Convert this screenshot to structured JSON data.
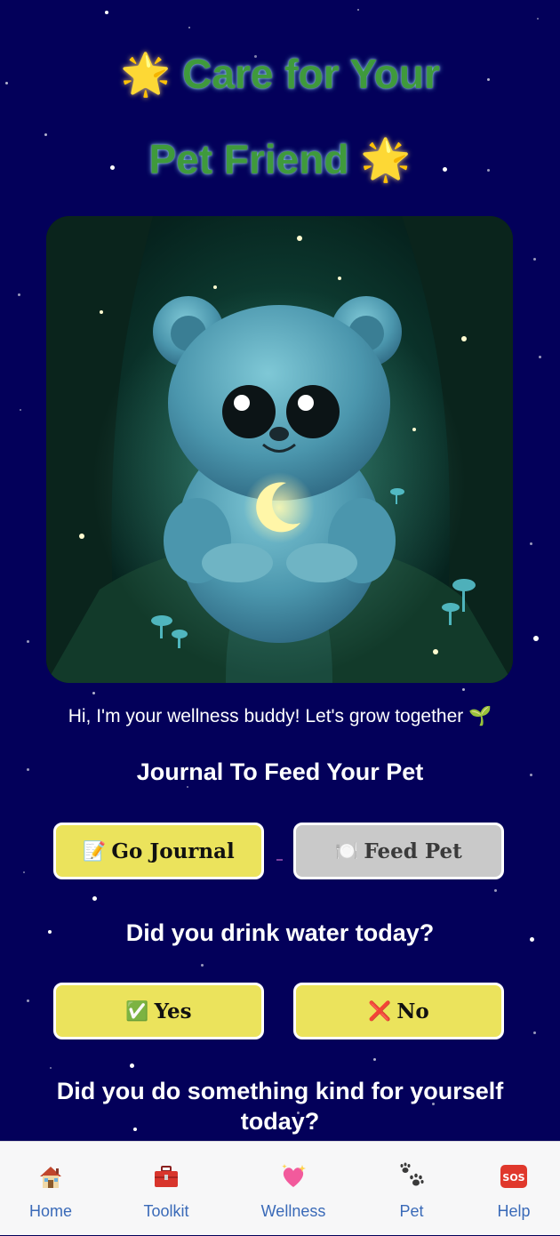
{
  "header": {
    "title_line1": "Care for Your",
    "title_line2": "Pet Friend",
    "star_emoji": "🌟"
  },
  "pet": {
    "image_alt": "Glowing blue bear cub with crescent moon in a forest"
  },
  "greeting": "Hi, I'm your wellness buddy! Let's grow together 🌱",
  "journal_section": {
    "heading": "Journal To Feed Your Pet",
    "go_journal": {
      "icon": "📝",
      "label": "Go Journal"
    },
    "feed_pet": {
      "icon": "🍽️",
      "label": "Feed Pet"
    }
  },
  "water_section": {
    "question": "Did you drink water today?",
    "yes": {
      "icon": "✅",
      "label": "Yes"
    },
    "no": {
      "icon": "❌",
      "label": "No"
    }
  },
  "kindness_section": {
    "question": "Did you do something kind for yourself today?"
  },
  "bottom_nav": [
    {
      "icon": "house-icon",
      "label": "Home"
    },
    {
      "icon": "toolbox-icon",
      "label": "Toolkit"
    },
    {
      "icon": "sparkling-heart-icon",
      "label": "Wellness"
    },
    {
      "icon": "paw-prints-icon",
      "label": "Pet"
    },
    {
      "icon": "sos-icon",
      "label": "Help"
    }
  ],
  "colors": {
    "background": "#03005a",
    "title": "#3f9a3c",
    "button_yellow": "#ebe35c",
    "button_disabled": "#c9c9c9",
    "nav_label": "#3a6ab8"
  }
}
